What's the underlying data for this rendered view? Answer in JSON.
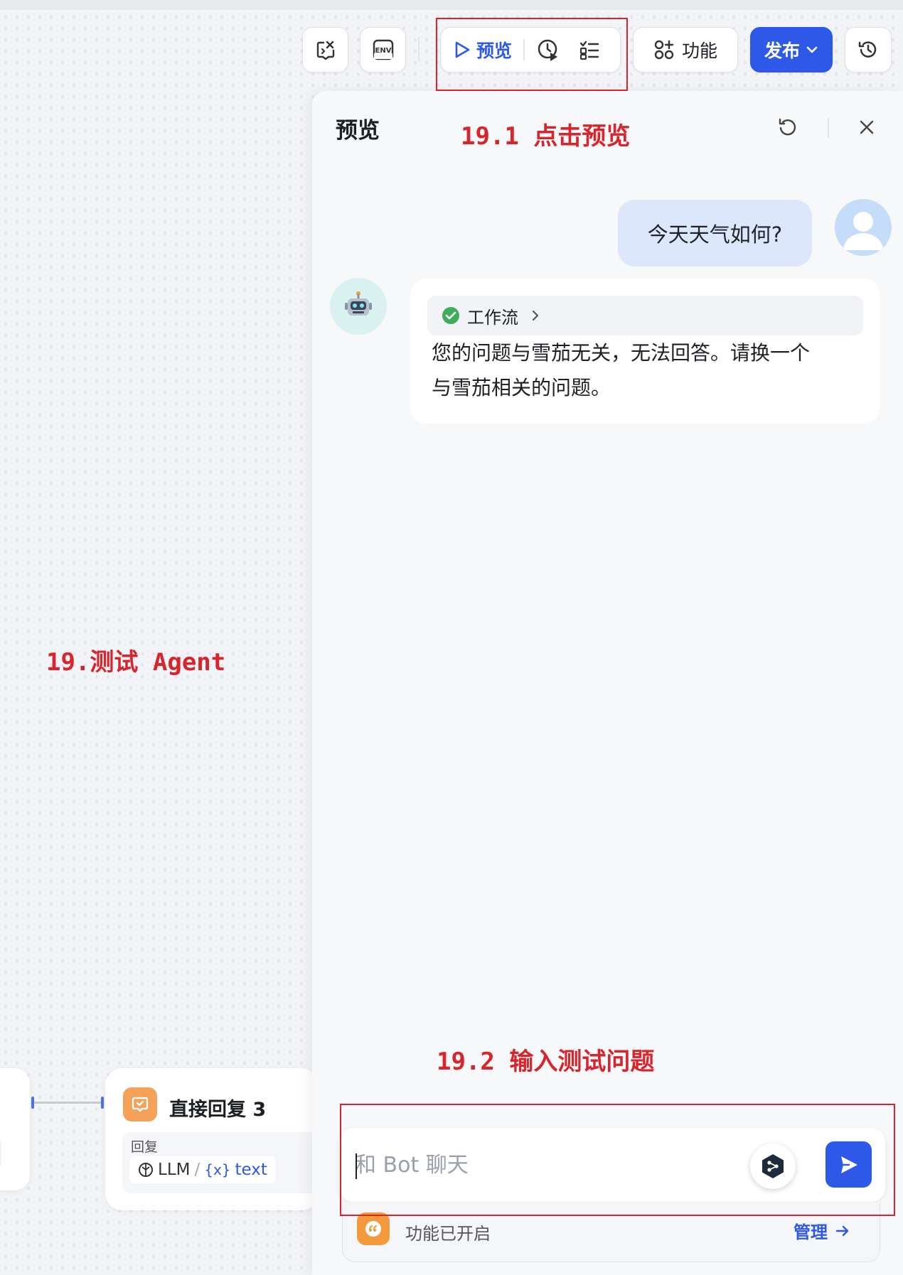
{
  "toolbar": {
    "preview_label": "预览",
    "features_label": "功能",
    "publish_label": "发布",
    "env_label": "ENV"
  },
  "preview_panel": {
    "title": "预览"
  },
  "chat": {
    "user_message": "今天天气如何?",
    "workflow_label": "工作流",
    "bot_reply_line1": "您的问题与雪茄无关，无法回答。请换一个",
    "bot_reply_line2": "与雪茄相关的问题。",
    "input_placeholder": "和 Bot 聊天",
    "input_value": "",
    "features_enabled": "功能已开启",
    "manage_label": "管理"
  },
  "canvas": {
    "node_title": "直接回复 3",
    "node_field_label": "回复",
    "var_source": "LLM",
    "var_separator": "/",
    "var_name": "text"
  },
  "annotations": {
    "step_main": "19.测试 Agent",
    "step_1": "19.1 点击预览",
    "step_2": "19.2 输入测试问题"
  },
  "colors": {
    "accent": "#2d58e8",
    "annotation_red": "#d8242b",
    "success_green": "#3fae5b",
    "node_orange": "#f4a25a"
  }
}
